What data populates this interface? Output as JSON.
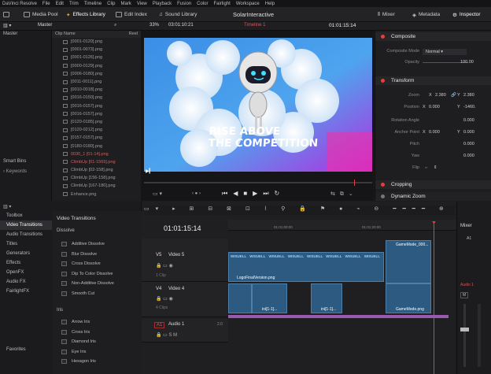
{
  "menubar": [
    "DaVinci Resolve",
    "File",
    "Edit",
    "Trim",
    "Timeline",
    "Clip",
    "Mark",
    "View",
    "Playback",
    "Fusion",
    "Color",
    "Fairlight",
    "Workspace",
    "Help"
  ],
  "toolbar": {
    "media_pool": "Media Pool",
    "effects_library": "Effects Library",
    "edit_index": "Edit Index",
    "sound_library": "Sound Library",
    "project_title": "SolarInteractive",
    "mixer": "Mixer",
    "metadata": "Metadata",
    "inspector": "Inspector"
  },
  "subbar": {
    "bin": "Master",
    "zoom": "33%",
    "source_tc": "03:01:10:21",
    "timeline_name": "Timeline 1",
    "record_tc": "01:01:15:14"
  },
  "bins": {
    "master": "Master",
    "smart_bins": "Smart Bins",
    "keywords": "Keywords"
  },
  "clip_list": {
    "header": "Clip Name",
    "header2": "Reel",
    "clips": [
      "[0001-0120].png",
      "[0001-0073].png",
      "[0001-0126].png",
      "[0000-0129].png",
      "[0006-0180].png",
      "[0011-0011].png",
      "[0010-0018].png",
      "[0016-0150].png",
      "[0016-0157].png",
      "[0016-0157].png",
      "[0120-0185].png",
      "[0120-0212].png",
      "[0157-0157].png",
      "[0180-0180].png",
      "0030_1 [01-14].png",
      "ClimbUp [01-1569].png",
      "ClimbUp [02-158].png",
      "ClimbUp [156-158].png",
      "ClimbUp [167-180].png",
      "Enhance.png"
    ]
  },
  "video": {
    "line1": "RISE ABOVE",
    "line2": "THE COMPETITION"
  },
  "inspector": {
    "composite": "Composite",
    "composite_mode_label": "Composite Mode",
    "composite_mode": "Normal",
    "opacity_label": "Opacity",
    "opacity": "100.00",
    "transform": "Transform",
    "zoom_label": "Zoom",
    "zoom_x": "2.380",
    "zoom_y": "2.380",
    "position_label": "Position",
    "pos_x": "0.000",
    "pos_y": "-1460.",
    "rotation_label": "Rotation Angle",
    "rotation": "0.000",
    "anchor_label": "Anchor Point",
    "anchor_x": "0.000",
    "anchor_y": "0.000",
    "pitch_label": "Pitch",
    "pitch": "0.000",
    "yaw_label": "Yaw",
    "yaw": "0.000",
    "flip_label": "Flip",
    "cropping": "Cropping",
    "dynamic_zoom": "Dynamic Zoom"
  },
  "fx_tree": [
    "Toolbox",
    "Video Transitions",
    "Audio Transitions",
    "Titles",
    "Generators",
    "Effects",
    "OpenFX",
    "Audio FX",
    "FairlightFX",
    "Favorites"
  ],
  "fx_list": {
    "header": "Video Transitions",
    "dissolve": "Dissolve",
    "dissolves": [
      "Additive Dissolve",
      "Blur Dissolve",
      "Cross Dissolve",
      "Dip To Color Dissolve",
      "Non-Additive Dissolve",
      "Smooth Cut"
    ],
    "iris": "Iris",
    "irises": [
      "Arrow Iris",
      "Cross Iris",
      "Diamond Iris",
      "Eye Iris",
      "Hexagon Iris"
    ]
  },
  "timeline": {
    "timecode": "01:01:15:14",
    "ruler": [
      "01:01:00:00",
      "01:01:20:00",
      "01:01:50:00"
    ],
    "v5_id": "V5",
    "v5_name": "Video 5",
    "v5_clips": "1 Clip",
    "v4_id": "V4",
    "v4_name": "Video 4",
    "v4_clips": "4 Clips",
    "a1_id": "A1",
    "a1_name": "Audio 1",
    "a1_ch": "2.0",
    "clip_logo": "LogoFinalVersion.png",
    "clip_gm1": "GameMode_000...",
    "clip_gm2": "GameMode.png",
    "clip_j1": "ini[1-1]...",
    "clip_j2": "ini[1-1]...",
    "watermark": "WISUELL"
  },
  "mixer": {
    "title": "Mixer",
    "a1": "A1",
    "audio1": "Audio 1",
    "m_label": "M"
  },
  "colors": {
    "accent": "#e04040",
    "clip_blue": "#2c5a80",
    "video_bg": "#2a86e0"
  }
}
